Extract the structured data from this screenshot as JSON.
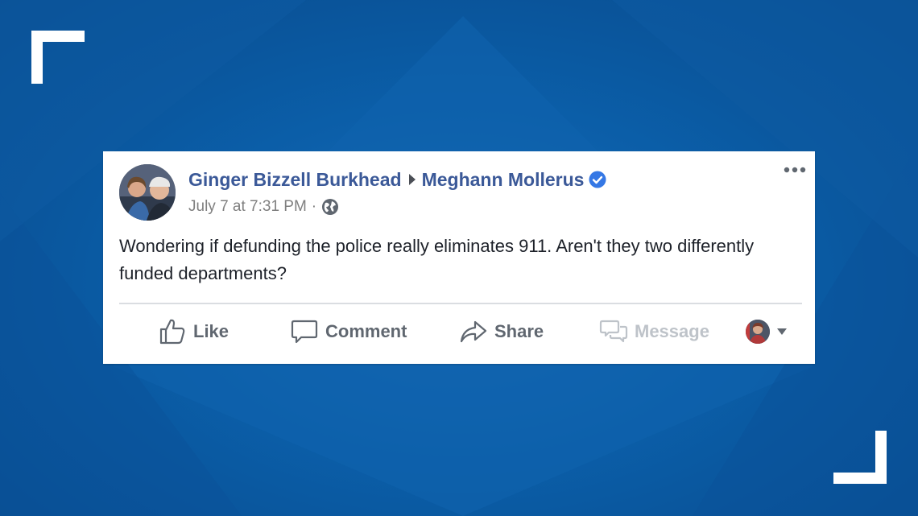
{
  "post": {
    "author": "Ginger Bizzell Burkhead",
    "recipient": "Meghann Mollerus",
    "timestamp": "July 7 at 7:31 PM",
    "separator": "·",
    "text": "Wondering if defunding the police really eliminates 911. Aren't they two differently funded departments?",
    "audience_icon": "globe-icon",
    "verified_icon": "verified-badge-icon"
  },
  "actions": {
    "like": "Like",
    "comment": "Comment",
    "share": "Share",
    "message": "Message"
  },
  "colors": {
    "background": "#0b5ea8",
    "name_link": "#3b5998",
    "verified": "#3578e5",
    "action_text": "#606770",
    "disabled_text": "#bec3c9",
    "corner_brackets": "#ffffff"
  }
}
